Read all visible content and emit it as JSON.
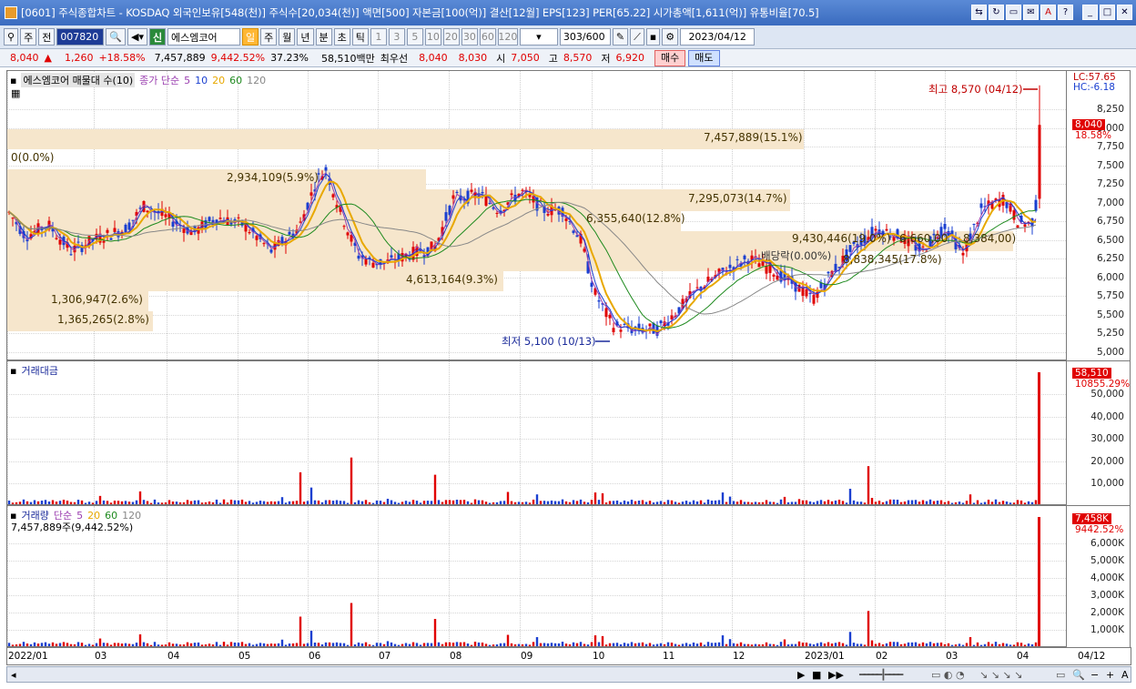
{
  "titlebar": {
    "text": "[0601] 주식종합차트 - KOSDAQ 외국인보유[548(천)] 주식수[20,034(천)] 액면[500] 자본금[100(억)] 결산[12월] EPS[123] PER[65.22] 시가총액[1,611(억)] 유통비율[70.5]"
  },
  "toolbar": {
    "period_type": "주",
    "prev": "전",
    "code": "007820",
    "name": "에스엠코어",
    "periods": [
      "일",
      "주",
      "월",
      "년",
      "분",
      "초",
      "틱"
    ],
    "minutes": [
      "1",
      "3",
      "5",
      "10",
      "20",
      "30",
      "60",
      "120"
    ],
    "page": "303/600",
    "date": "2023/04/12"
  },
  "info": {
    "price": "8,040",
    "change": "1,260",
    "rate": "+18.58%",
    "volume": "7,457,889",
    "vol_ratio": "9,442.52%",
    "turnover": "37.23%",
    "amount": "58,510백만",
    "bid_label": "최우선",
    "bid": "8,040",
    "ask": "8,030",
    "open_label": "시",
    "open": "7,050",
    "high_label": "고",
    "high": "8,570",
    "low_label": "저",
    "low": "6,920",
    "buy": "매수",
    "sell": "매도"
  },
  "price_panel": {
    "title": "에스엠코어 매물대 수(10)",
    "ma_label": "종가 단순",
    "ma": [
      {
        "period": "5",
        "color": "#9b3fb0"
      },
      {
        "period": "10",
        "color": "#1a3fd0"
      },
      {
        "period": "20",
        "color": "#e8a800"
      },
      {
        "period": "60",
        "color": "#1e8a1e"
      },
      {
        "period": "120",
        "color": "#888888"
      }
    ],
    "lc": "LC:57.65",
    "hc": "HC:-6.18",
    "current_tag": "8,040",
    "rate_tag": "18.58%",
    "ticks": [
      "8,250",
      "8,000",
      "7,750",
      "7,500",
      "7,250",
      "7,000",
      "6,750",
      "6,500",
      "6,250",
      "6,000",
      "5,750",
      "5,500",
      "5,250",
      "5,000"
    ],
    "volume_profile": [
      {
        "label": "0(0.0%)"
      },
      {
        "label": "7,457,889(15.1%)"
      },
      {
        "label": "2,934,109(5.9%)"
      },
      {
        "label": "7,295,073(14.7%)"
      },
      {
        "label": "6,355,640(12.8%)"
      },
      {
        "label": "9,430,446(19.0%)"
      },
      {
        "label": "6,660,00"
      },
      {
        "label": "8,384,00)"
      },
      {
        "label": "8,838,345(17.8%)"
      },
      {
        "label": "4,613,164(9.3%)"
      },
      {
        "label": "1,306,947(2.6%)"
      },
      {
        "label": "1,365,265(2.8%)"
      }
    ],
    "ex_div": "배당락(0.00%)",
    "high_note": "최고 8,570 (04/12)",
    "low_note": "최저 5,100 (10/13)"
  },
  "amount_panel": {
    "title": "거래대금",
    "tag1": "58,510",
    "tag2": "10855.29%",
    "ticks": [
      "50,000",
      "40,000",
      "30,000",
      "20,000",
      "10,000"
    ]
  },
  "volume_panel": {
    "title": "거래량",
    "ma_label": "단순",
    "ma": [
      "5",
      "20",
      "60",
      "120"
    ],
    "current": "7,457,889주(9,442.52%)",
    "tag1": "7,458K",
    "tag2": "9442.52%",
    "ticks": [
      "6,000K",
      "5,000K",
      "4,000K",
      "3,000K",
      "2,000K",
      "1,000K"
    ]
  },
  "xaxis": {
    "labels": [
      "2022/01",
      "03",
      "04",
      "05",
      "06",
      "07",
      "08",
      "09",
      "10",
      "11",
      "12",
      "2023/01",
      "02",
      "03",
      "04"
    ],
    "right": "04/12"
  },
  "chart_data": {
    "type": "candlestick",
    "title": "에스엠코어 주식종합차트",
    "ylim": [
      5000,
      8570
    ],
    "high": 8570,
    "low": 5100,
    "last": 8040
  },
  "colors": {
    "up": "#e00000",
    "down": "#1a3fd0",
    "band": "#f6e6cc"
  }
}
